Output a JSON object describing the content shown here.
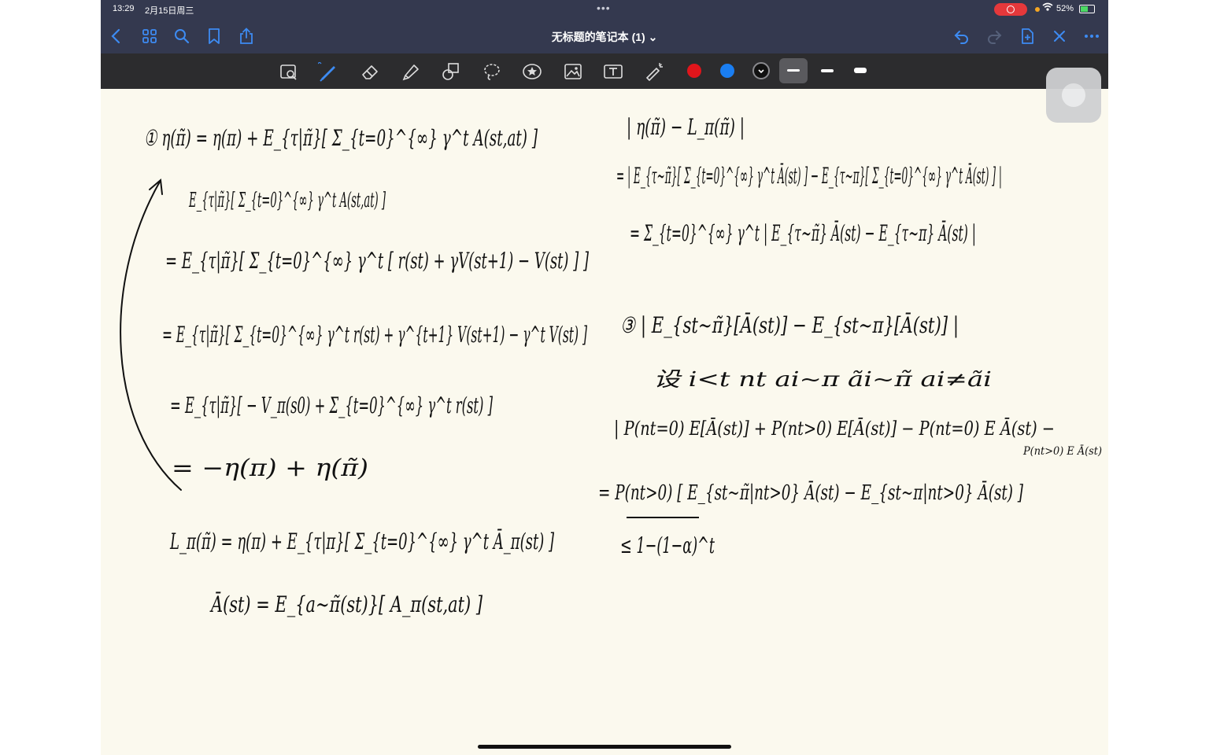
{
  "status": {
    "time": "13:29",
    "date": "2月15日周三",
    "battery": "52%",
    "wifi_icon": "wifi-icon"
  },
  "nav": {
    "title": "无标题的笔记本 (1) ⌄"
  },
  "toolbar": {
    "colors": [
      "#e0151b",
      "#1a7ef2",
      "#111111"
    ]
  },
  "notes": {
    "left": [
      "① η(π̃) = η(π) + E_{τ|π̃}[ Σ_{t=0}^{∞} γ^t A(st,at) ]",
      "E_{τ|π̃}[ Σ_{t=0}^{∞} γ^t A(st,at) ]",
      "= E_{τ|π̃}[ Σ_{t=0}^{∞} γ^t [ r(st) + γV(st+1) − V(st) ] ]",
      "= E_{τ|π̃}[ Σ_{t=0}^{∞} γ^t r(st) + γ^{t+1} V(st+1) − γ^t V(st) ]",
      "= E_{τ|π̃}[ − V_π(s0) + Σ_{t=0}^{∞} γ^t r(st) ]",
      "= −η(π) + η(π̃)",
      "L_π(π̃) = η(π) + E_{τ|π}[ Σ_{t=0}^{∞} γ^t Ā_π(st) ]",
      "Ā(st) = E_{a~π̃(st)}[ A_π(st,at) ]"
    ],
    "right": [
      "| η(π̃) − L_π(π̃) |",
      "= | E_{τ~π̃}[ Σ_{t=0}^{∞} γ^t Ā(st) ] − E_{τ~π}[ Σ_{t=0}^{∞} γ^t Ā(st) ] |",
      "= Σ_{t=0}^{∞} γ^t | E_{τ~π̃} Ā(st) − E_{τ~π} Ā(st) |",
      "③ | E_{st~π̃}[Ā(st)] − E_{st~π}[Ā(st)] |",
      "设 i<t  nt   ai~π  ãi~π̃   ai≠ãi",
      "| P(nt=0) E[Ā(st)] + P(nt>0) E[Ā(st)] − P(nt=0) E Ā(st) −",
      "P(nt>0) E Ā(st)",
      "= P(nt>0) [ E_{st~π̃|nt>0} Ā(st) − E_{st~π|nt>0} Ā(st) ]",
      "≤ 1−(1−α)^t"
    ]
  }
}
